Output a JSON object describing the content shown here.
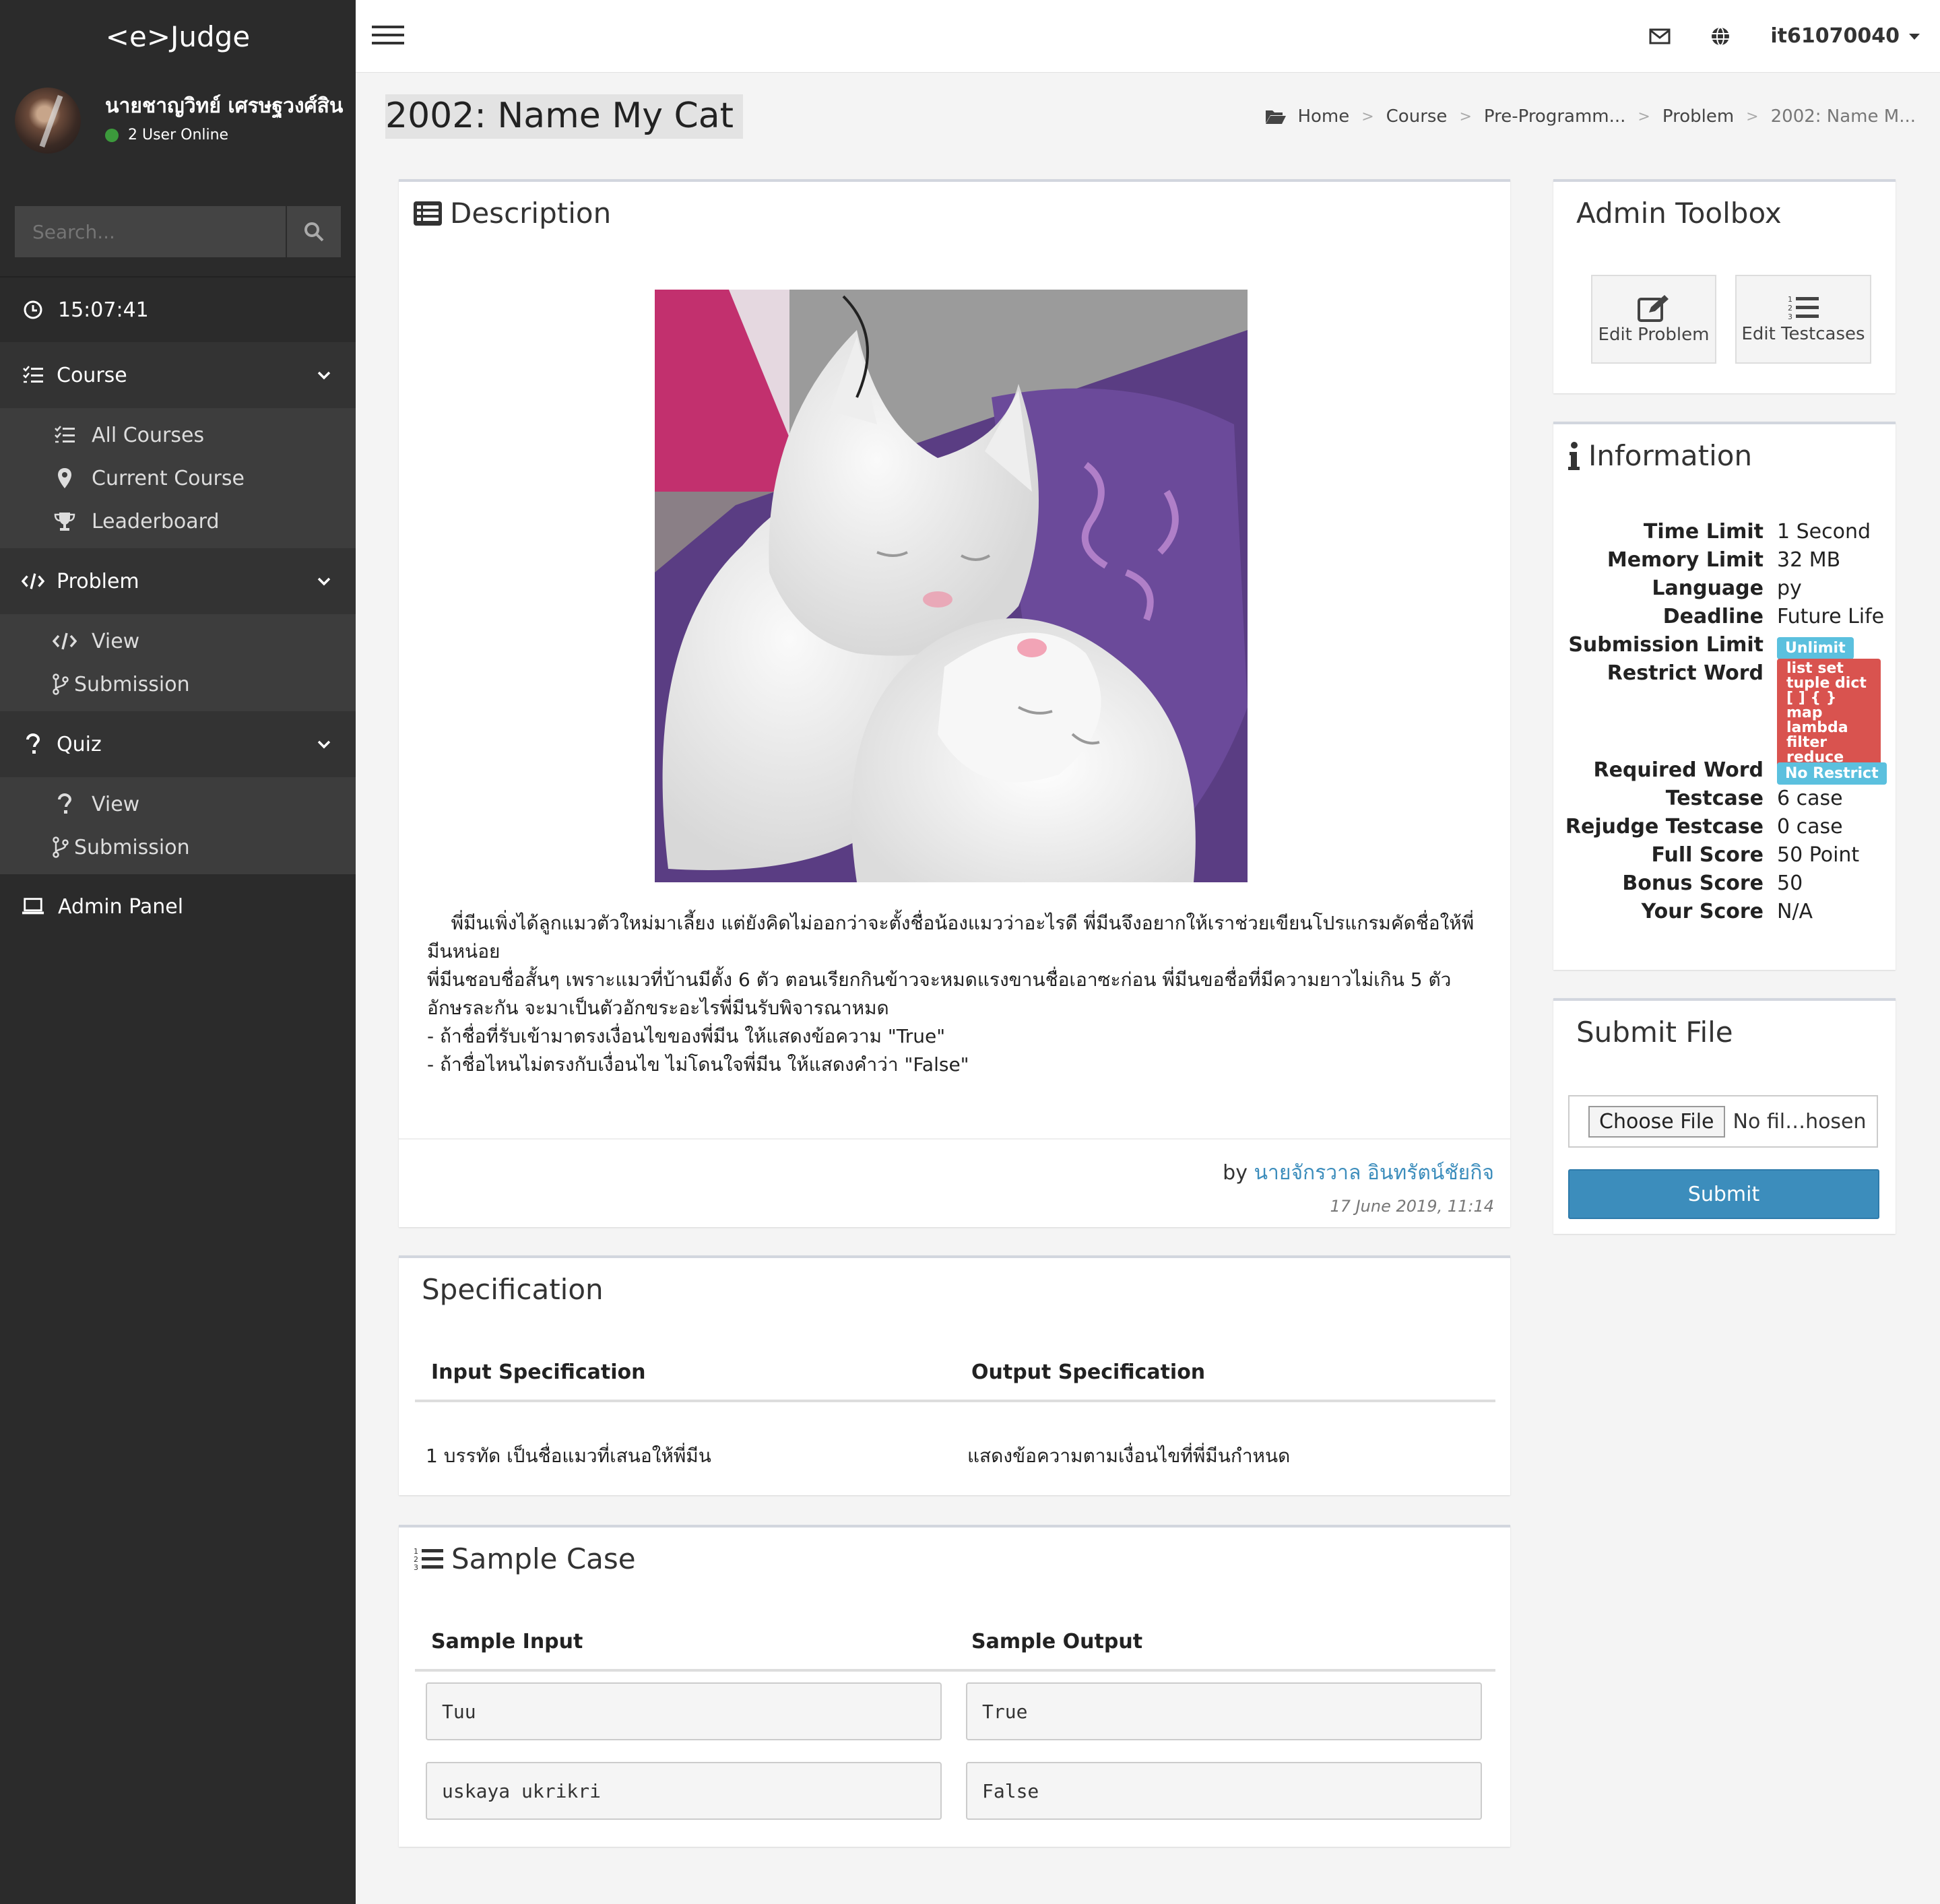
{
  "brand": "<e>Judge",
  "user": {
    "name": "นายชาญวิทย์ เศรษฐวงศ์สิน",
    "status": "2 User Online"
  },
  "search": {
    "placeholder": "Search..."
  },
  "clock": "15:07:41",
  "nav": {
    "course": {
      "label": "Course",
      "items": [
        "All Courses",
        "Current Course",
        "Leaderboard"
      ]
    },
    "problem": {
      "label": "Problem",
      "items": [
        "View",
        "Submission"
      ]
    },
    "quiz": {
      "label": "Quiz",
      "items": [
        "View",
        "Submission"
      ]
    },
    "admin": "Admin Panel"
  },
  "topbar": {
    "username": "it61070040"
  },
  "page": {
    "title": "2002: Name My Cat",
    "breadcrumb": [
      "Home",
      "Course",
      "Pre-Programm...",
      "Problem",
      "2002: Name M..."
    ]
  },
  "description": {
    "title": "Description",
    "lines": [
      "    พี่มีนเพิ่งได้ลูกแมวตัวใหม่มาเลี้ยง แต่ยังคิดไม่ออกว่าจะตั้งชื่อน้องแมวว่าอะไรดี พี่มีนจึงอยากให้เราช่วยเขียนโปรแกรมคัดชื่อให้พี่มีนหน่อย",
      "พี่มีนชอบชื่อสั้นๆ เพราะแมวที่บ้านมีตั้ง 6 ตัว ตอนเรียกกินข้าวจะหมดแรงขานชื่อเอาซะก่อน พี่มีนขอชื่อที่มีความยาวไม่เกิน 5 ตัวอักษรละกัน จะมาเป็นตัวอักขระอะไรพี่มีนรับพิจารณาหมด",
      "- ถ้าชื่อที่รับเข้ามาตรงเงื่อนไขของพี่มีน ให้แสดงข้อความ \"True\"",
      "- ถ้าชื่อไหนไม่ตรงกับเงื่อนไข ไม่โดนใจพี่มีน ให้แสดงคำว่า \"False\""
    ],
    "by_prefix": "by",
    "author": "นายจักรวาล อินทรัตน์ชัยกิจ",
    "date": "17 June 2019, 11:14"
  },
  "specification": {
    "title": "Specification",
    "input_header": "Input Specification",
    "output_header": "Output Specification",
    "input": "1 บรรทัด เป็นชื่อแมวที่เสนอให้พี่มีน",
    "output": "แสดงข้อความตามเงื่อนไขที่พี่มีนกำหนด"
  },
  "samples": {
    "title": "Sample Case",
    "input_header": "Sample Input",
    "output_header": "Sample Output",
    "cases": [
      {
        "input": "Tuu",
        "output": "True"
      },
      {
        "input": "uskaya ukrikri",
        "output": "False"
      }
    ]
  },
  "toolbox": {
    "title": "Admin Toolbox",
    "edit_problem": "Edit Problem",
    "edit_testcases": "Edit Testcases"
  },
  "information": {
    "title": "Information",
    "rows": [
      {
        "k": "Time Limit",
        "v": "1 Second"
      },
      {
        "k": "Memory Limit",
        "v": "32 MB"
      },
      {
        "k": "Language",
        "v": "py"
      },
      {
        "k": "Deadline",
        "v": "Future Life"
      },
      {
        "k": "Submission Limit",
        "v": "Unlimit"
      },
      {
        "k": "Restrict Word",
        "v": "list set tuple dict [ ] { } map lambda filter reduce"
      },
      {
        "k": "Required Word",
        "v": "No Restrict"
      },
      {
        "k": "Testcase",
        "v": "6 case"
      },
      {
        "k": "Rejudge Testcase",
        "v": "0 case"
      },
      {
        "k": "Full Score",
        "v": "50 Point"
      },
      {
        "k": "Bonus Score",
        "v": "50"
      },
      {
        "k": "Your Score",
        "v": "N/A"
      }
    ]
  },
  "submit_file": {
    "title": "Submit File",
    "choose": "Choose File",
    "no_file": "No fil…hosen",
    "submit": "Submit"
  },
  "colors": {
    "sidebar": "#2b2b2b",
    "primary": "#3c8dbc",
    "label_info": "#5bc0de",
    "label_danger": "#d9534f"
  }
}
